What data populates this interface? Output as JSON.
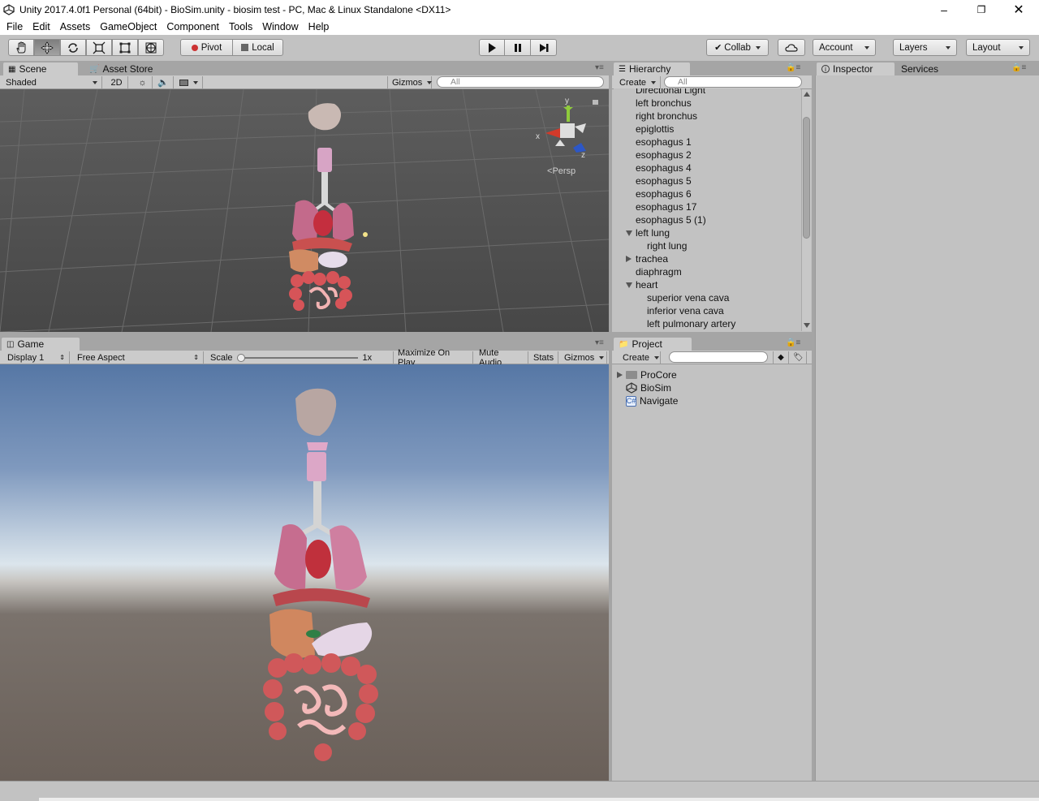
{
  "window": {
    "title": "Unity 2017.4.0f1 Personal (64bit) - BioSim.unity - biosim test - PC, Mac & Linux Standalone <DX11>"
  },
  "menu": [
    "File",
    "Edit",
    "Assets",
    "GameObject",
    "Component",
    "Tools",
    "Window",
    "Help"
  ],
  "toolbar": {
    "pivot": "Pivot",
    "local": "Local",
    "collab": "Collab",
    "account": "Account",
    "layers": "Layers",
    "layout": "Layout"
  },
  "scene": {
    "tab": "Scene",
    "asset_store_tab": "Asset Store",
    "shading": "Shaded",
    "mode_2d": "2D",
    "gizmos": "Gizmos",
    "search_placeholder": "All",
    "persp": "Persp",
    "axis_x": "x",
    "axis_y": "y",
    "axis_z": "z"
  },
  "game": {
    "tab": "Game",
    "display": "Display 1",
    "aspect": "Free Aspect",
    "scale_label": "Scale",
    "scale_value": "1x",
    "maximize": "Maximize On Play",
    "mute": "Mute Audio",
    "stats": "Stats",
    "gizmos": "Gizmos"
  },
  "hierarchy": {
    "tab": "Hierarchy",
    "create": "Create",
    "search_placeholder": "All",
    "items": [
      {
        "label": "Directional Light",
        "indent": 0,
        "arrow": ""
      },
      {
        "label": "left bronchus",
        "indent": 0,
        "arrow": ""
      },
      {
        "label": "right bronchus",
        "indent": 0,
        "arrow": ""
      },
      {
        "label": "epiglottis",
        "indent": 0,
        "arrow": ""
      },
      {
        "label": "esophagus 1",
        "indent": 0,
        "arrow": ""
      },
      {
        "label": "esophagus 2",
        "indent": 0,
        "arrow": ""
      },
      {
        "label": "esophagus 4",
        "indent": 0,
        "arrow": ""
      },
      {
        "label": "esophagus 5",
        "indent": 0,
        "arrow": ""
      },
      {
        "label": "esophagus 6",
        "indent": 0,
        "arrow": ""
      },
      {
        "label": "esophagus 17",
        "indent": 0,
        "arrow": ""
      },
      {
        "label": "esophagus 5 (1)",
        "indent": 0,
        "arrow": ""
      },
      {
        "label": "left lung",
        "indent": 0,
        "arrow": "down"
      },
      {
        "label": "right lung",
        "indent": 1,
        "arrow": ""
      },
      {
        "label": "trachea",
        "indent": 0,
        "arrow": "right"
      },
      {
        "label": "diaphragm",
        "indent": 0,
        "arrow": ""
      },
      {
        "label": "heart",
        "indent": 0,
        "arrow": "down"
      },
      {
        "label": "superior vena cava",
        "indent": 1,
        "arrow": ""
      },
      {
        "label": "inferior vena cava",
        "indent": 1,
        "arrow": ""
      },
      {
        "label": "left pulmonary artery",
        "indent": 1,
        "arrow": ""
      }
    ]
  },
  "project": {
    "tab": "Project",
    "create": "Create",
    "items": [
      {
        "label": "ProCore",
        "icon": "folder-icon"
      },
      {
        "label": "BioSim",
        "icon": "unity-scene-icon"
      },
      {
        "label": "Navigate",
        "icon": "script-icon"
      }
    ]
  },
  "inspector": {
    "tab": "Inspector",
    "services_tab": "Services"
  }
}
